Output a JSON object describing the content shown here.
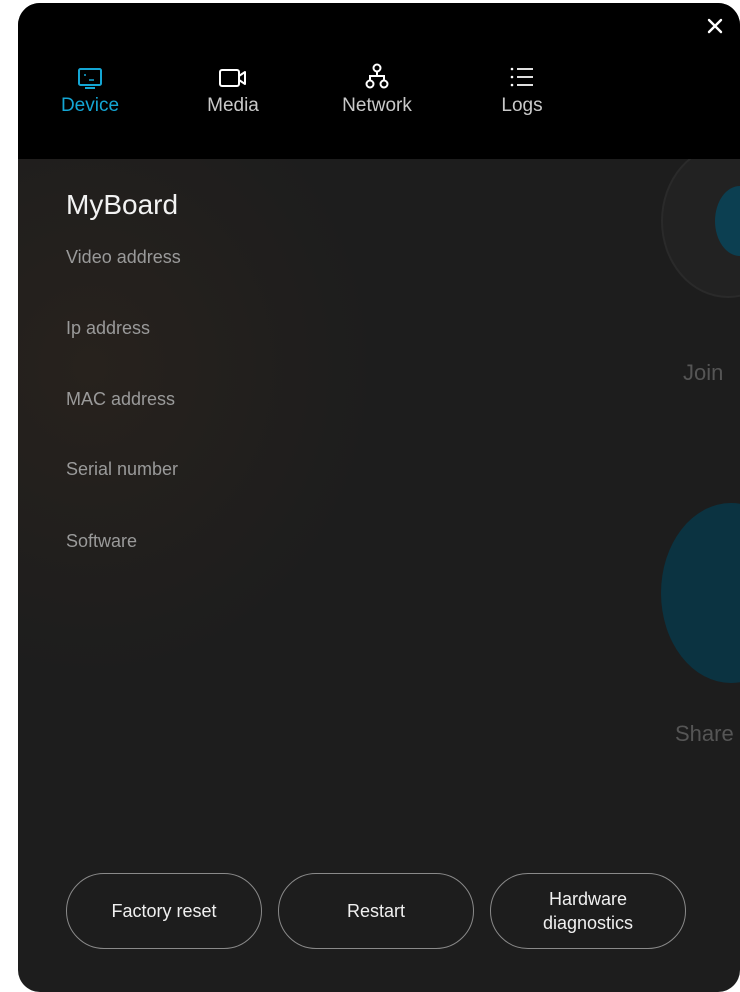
{
  "tabs": [
    {
      "label": "Device",
      "icon": "device-icon",
      "active": true
    },
    {
      "label": "Media",
      "icon": "camera-icon",
      "active": false
    },
    {
      "label": "Network",
      "icon": "network-icon",
      "active": false
    },
    {
      "label": "Logs",
      "icon": "list-icon",
      "active": false
    }
  ],
  "device": {
    "name": "MyBoard",
    "fields": [
      {
        "label": "Video address",
        "value": ""
      },
      {
        "label": "Ip address",
        "value": ""
      },
      {
        "label": "MAC address",
        "value": ""
      },
      {
        "label": "Serial number",
        "value": ""
      },
      {
        "label": "Software",
        "value": ""
      }
    ]
  },
  "background": {
    "join_label": "Join",
    "share_label": "Share"
  },
  "actions": {
    "factory_reset": "Factory reset",
    "restart": "Restart",
    "hardware_diagnostics_line1": "Hardware",
    "hardware_diagnostics_line2": "diagnostics"
  },
  "colors": {
    "accent": "#14a6d4",
    "panel_bg": "#1d1d1d",
    "header_bg": "#000000"
  }
}
